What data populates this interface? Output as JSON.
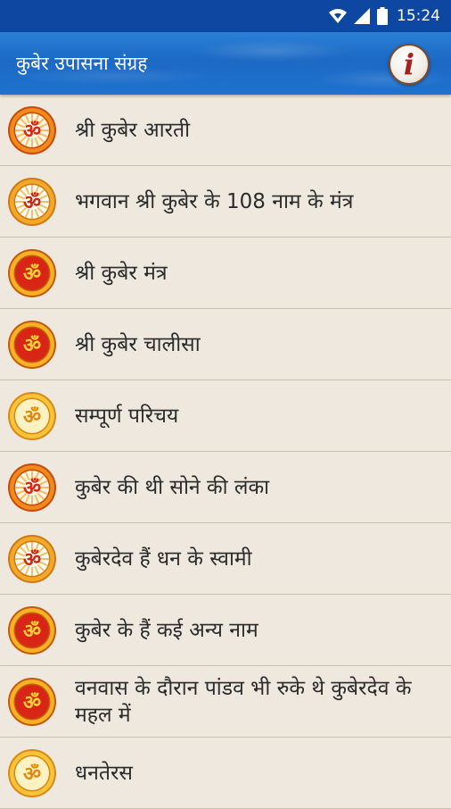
{
  "status_bar": {
    "time": "15:24",
    "icons": [
      "wifi-icon",
      "signal-icon",
      "battery-icon"
    ]
  },
  "app_bar": {
    "title": "कुबेर उपासना संग्रह",
    "info_icon": "info-icon",
    "info_glyph": "i"
  },
  "items": [
    {
      "label": "श्री कुबेर आरती",
      "icon": "om-sun-icon"
    },
    {
      "label": "भगवान श्री कुबेर के 108 नाम के मंत्र",
      "icon": "om-white-icon"
    },
    {
      "label": "श्री कुबेर मंत्र",
      "icon": "om-red-icon"
    },
    {
      "label": "श्री कुबेर चालीसा",
      "icon": "om-red-icon"
    },
    {
      "label": "सम्पूर्ण परिचय",
      "icon": "om-gold-icon"
    },
    {
      "label": "कुबेर की थी सोने की लंका",
      "icon": "om-sun-icon"
    },
    {
      "label": "कुबेरदेव हैं धन के स्वामी",
      "icon": "om-white-icon"
    },
    {
      "label": "कुबेर के हैं कई अन्य नाम",
      "icon": "om-red-icon"
    },
    {
      "label": "वनवास के दौरान पांडव भी रुके थे कुबेरदेव के महल में",
      "icon": "om-red-icon"
    },
    {
      "label": "धनतेरस",
      "icon": "om-gold-icon"
    }
  ],
  "colors": {
    "status_bar": "#0d47a1",
    "app_bar": "#1b69c4",
    "background": "#efe8df",
    "divider": "#c9bda9"
  }
}
